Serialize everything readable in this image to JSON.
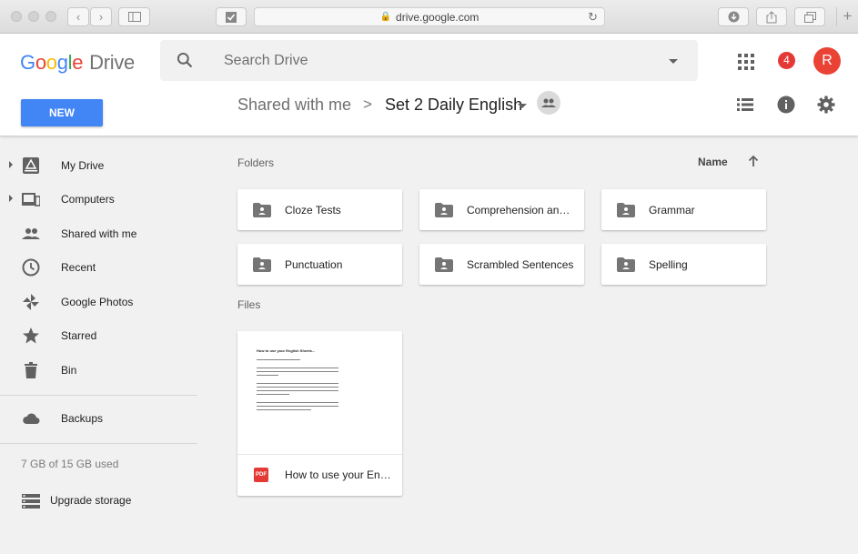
{
  "browser": {
    "url": "drive.google.com"
  },
  "header": {
    "logo": {
      "g": "G",
      "o1": "o",
      "o2": "o",
      "g2": "g",
      "l": "l",
      "e": "e",
      "drive": "Drive"
    },
    "search_placeholder": "Search Drive",
    "notification_count": "4",
    "avatar_initial": "R",
    "new_label": "NEW",
    "breadcrumb": {
      "parent": "Shared with me",
      "separator": ">",
      "current": "Set 2 Daily English"
    }
  },
  "sidebar": {
    "items": [
      {
        "label": "My Drive",
        "icon": "drive-icon"
      },
      {
        "label": "Computers",
        "icon": "computers-icon"
      },
      {
        "label": "Shared with me",
        "icon": "people-icon"
      },
      {
        "label": "Recent",
        "icon": "clock-icon"
      },
      {
        "label": "Google Photos",
        "icon": "pinwheel-icon"
      },
      {
        "label": "Starred",
        "icon": "star-icon"
      },
      {
        "label": "Bin",
        "icon": "trash-icon"
      },
      {
        "label": "Backups",
        "icon": "cloud-icon"
      }
    ],
    "storage": "7 GB of 15 GB used",
    "upgrade": "Upgrade storage"
  },
  "main": {
    "folders_label": "Folders",
    "files_label": "Files",
    "sort": {
      "label": "Name",
      "direction": "ascending"
    },
    "folders": [
      {
        "name": "Cloze Tests"
      },
      {
        "name": "Comprehension and Questions"
      },
      {
        "name": "Grammar"
      },
      {
        "name": "Punctuation"
      },
      {
        "name": "Scrambled Sentences"
      },
      {
        "name": "Spelling"
      }
    ],
    "files": [
      {
        "name": "How to use your English Sheets",
        "type": "PDF",
        "preview_title": "How to use your English Sheets..."
      }
    ]
  },
  "colors": {
    "accent": "#4285f4",
    "badge": "#e53935",
    "avatar": "#ea4335",
    "pdf": "#e53935"
  }
}
